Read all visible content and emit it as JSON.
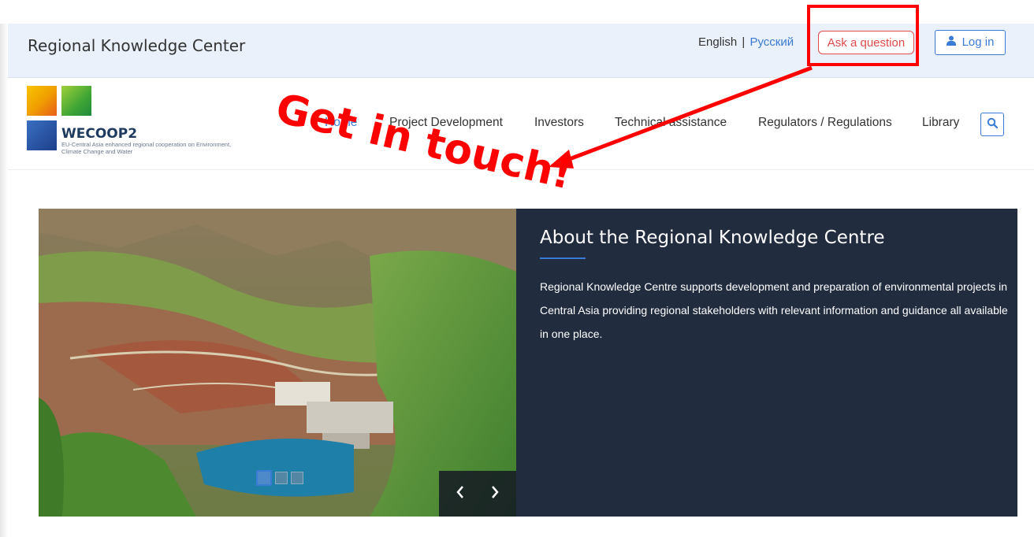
{
  "topbar": {
    "site_title": "Regional Knowledge Center",
    "lang_english": "English",
    "lang_separator": "|",
    "lang_russian": "Русский",
    "ask_question": "Ask a question",
    "login": "Log in",
    "login_icon": "user-icon"
  },
  "logo": {
    "brand": "WECOOP2",
    "tagline": "EU-Central Asia enhanced regional cooperation on Environment, Climate Change and Water"
  },
  "nav": {
    "items": [
      "Home",
      "Project Development",
      "Investors",
      "Technical assistance",
      "Regulators / Regulations",
      "Library"
    ],
    "search_icon": "search-icon"
  },
  "hero": {
    "title": "About the Regional Knowledge Centre",
    "text": "Regional Knowledge Centre supports development and preparation of environmental projects in Central Asia providing regional stakeholders with relevant information and guidance all available in one place.",
    "prev_icon": "chevron-left-icon",
    "next_icon": "chevron-right-icon",
    "slides": 3,
    "active_slide": 1
  },
  "annotation": {
    "text": "Get in touch!",
    "color": "#ff0000"
  },
  "colors": {
    "accent": "#3a7bd5",
    "topbar_bg": "#eaf1fb",
    "panel_bg": "#222c3f",
    "ask_red": "#e04a4a"
  }
}
